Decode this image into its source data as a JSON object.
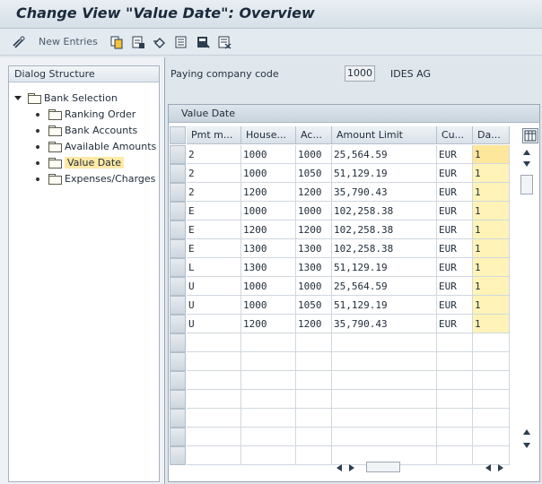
{
  "window": {
    "title": "Change View \"Value Date\": Overview"
  },
  "toolbar": {
    "new_entries_label": "New Entries",
    "icons": [
      "edit-glasses-icon",
      "copy-icon",
      "delete-icon",
      "undo-icon",
      "select-all-icon",
      "select-block-icon",
      "deselect-all-icon"
    ]
  },
  "tree": {
    "header": "Dialog Structure",
    "items": [
      {
        "label": "Bank Selection",
        "level": 0,
        "expanded": true
      },
      {
        "label": "Ranking Order",
        "level": 1
      },
      {
        "label": "Bank Accounts",
        "level": 1
      },
      {
        "label": "Available Amounts",
        "level": 1
      },
      {
        "label": "Value Date",
        "level": 1,
        "selected": true
      },
      {
        "label": "Expenses/Charges",
        "level": 1
      }
    ]
  },
  "form": {
    "paying_company_code_label": "Paying company code",
    "paying_company_code_value": "1000",
    "paying_company_code_desc": "IDES AG"
  },
  "table": {
    "caption": "Value Date",
    "columns": [
      "Pmt m...",
      "House...",
      "Ac...",
      "Amount Limit",
      "Cu...",
      "Da..."
    ],
    "rows": [
      [
        "2",
        "1000",
        "1000",
        "25,564.59",
        "EUR",
        "1"
      ],
      [
        "2",
        "1000",
        "1050",
        "51,129.19",
        "EUR",
        "1"
      ],
      [
        "2",
        "1200",
        "1200",
        "35,790.43",
        "EUR",
        "1"
      ],
      [
        "E",
        "1000",
        "1000",
        "102,258.38",
        "EUR",
        "1"
      ],
      [
        "E",
        "1200",
        "1200",
        "102,258.38",
        "EUR",
        "1"
      ],
      [
        "E",
        "1300",
        "1300",
        "102,258.38",
        "EUR",
        "1"
      ],
      [
        "L",
        "1300",
        "1300",
        "51,129.19",
        "EUR",
        "1"
      ],
      [
        "U",
        "1000",
        "1000",
        "25,564.59",
        "EUR",
        "1"
      ],
      [
        "U",
        "1000",
        "1050",
        "51,129.19",
        "EUR",
        "1"
      ],
      [
        "U",
        "1200",
        "1200",
        "35,790.43",
        "EUR",
        "1"
      ]
    ]
  }
}
